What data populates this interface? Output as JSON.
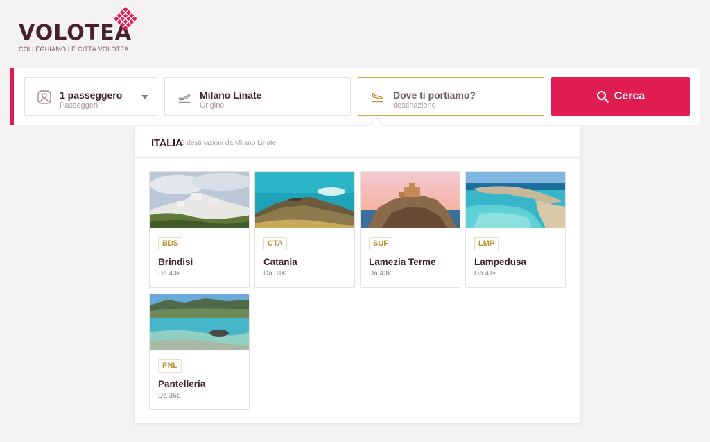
{
  "brand": {
    "name": "VOLOTEA",
    "tagline": "COLLEGHIAMO LE CITTÀ VOLOTEA",
    "accent": "#e01d50"
  },
  "search": {
    "passengers": {
      "value": "1 passeggero",
      "label": "Passeggeri",
      "icon": "person-icon"
    },
    "origin": {
      "value": "Milano Linate",
      "label": "Origine",
      "icon": "plane-takeoff-icon"
    },
    "destination": {
      "value": "Dove ti portiamo?",
      "label": "destinazione",
      "icon": "plane-landing-icon"
    },
    "button_label": "Cerca"
  },
  "panel": {
    "region": "ITALIA",
    "subtitle": "5 destinazioni da Milano Linate",
    "destinations": [
      {
        "code": "BDS",
        "city": "Brindisi",
        "price": "Da 43€"
      },
      {
        "code": "CTA",
        "city": "Catania",
        "price": "Da 31€"
      },
      {
        "code": "SUF",
        "city": "Lamezia Terme",
        "price": "Da 43€"
      },
      {
        "code": "LMP",
        "city": "Lampedusa",
        "price": "Da 41€"
      },
      {
        "code": "PNL",
        "city": "Pantelleria",
        "price": "Da 36€"
      }
    ]
  }
}
